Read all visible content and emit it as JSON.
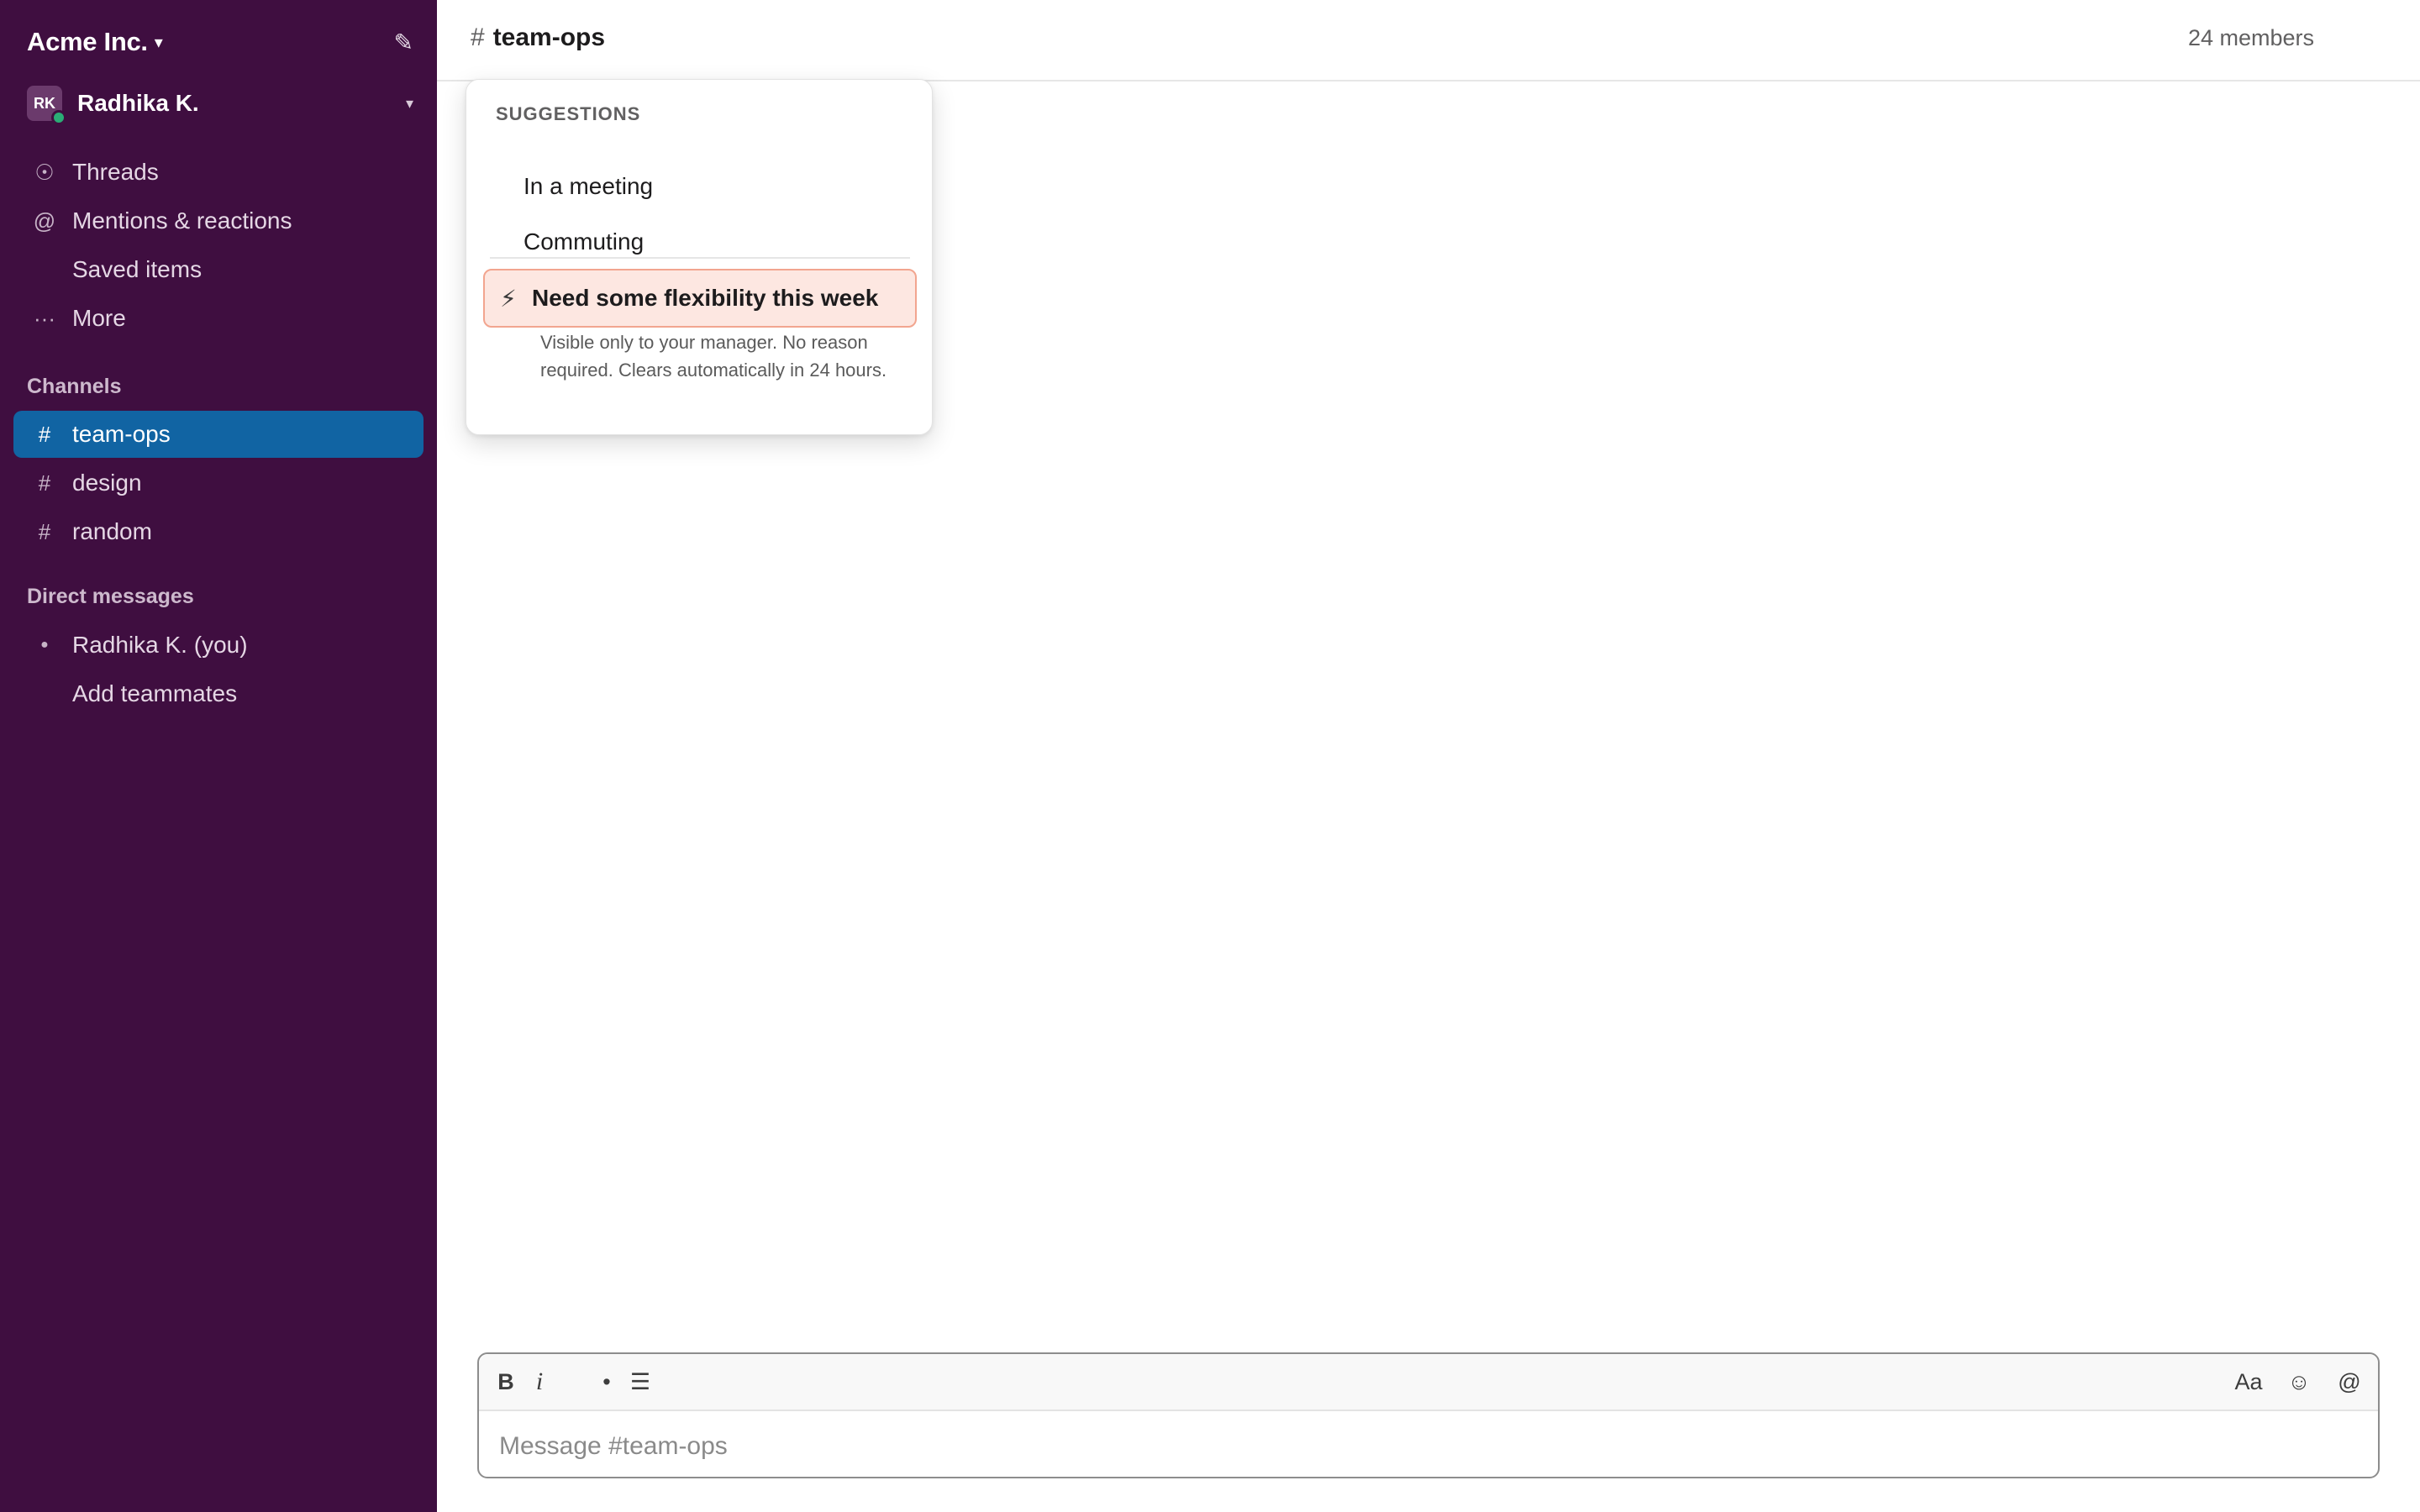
{
  "workspace": {
    "name": "Acme Inc.",
    "caret": "▾",
    "compose_icon": "✎"
  },
  "user": {
    "initials": "RK",
    "name": "Radhika K.",
    "caret": "▾",
    "status_color": "#2bac76"
  },
  "nav": [
    {
      "icon": "☉",
      "label": "Threads"
    },
    {
      "icon": "@",
      "label": "Mentions & reactions"
    },
    {
      "icon": "",
      "label": "Saved items"
    },
    {
      "icon": "···",
      "label": "More"
    }
  ],
  "channels": {
    "title": "Channels",
    "items": [
      {
        "icon": "#",
        "label": "team-ops"
      },
      {
        "icon": "#",
        "label": "design"
      },
      {
        "icon": "#",
        "label": "random"
      }
    ]
  },
  "dms": {
    "title": "Direct messages",
    "items": [
      {
        "icon": "●",
        "label": "Radhika K. (you)"
      },
      {
        "icon": "",
        "label": "Add teammates"
      }
    ]
  },
  "header": {
    "hash": "#",
    "channel": "team-ops",
    "members": "24 members",
    "icon1": "",
    "icon2": ""
  },
  "popover": {
    "label": "SUGGESTIONS",
    "suggestions": [
      {
        "icon": "",
        "label": "In a meeting"
      },
      {
        "icon": "",
        "label": "Commuting"
      }
    ],
    "flex": {
      "icon": "⚡",
      "label": "Need some flexibility this week",
      "desc": "Visible only to your manager. No reason required. Clears automatically in 24 hours."
    }
  },
  "composer": {
    "bold": "B",
    "italic": "i",
    "link": "",
    "bullet": "•",
    "list": "☰",
    "format": "Aa",
    "emoji": "☺",
    "mention": "@",
    "placeholder": "Message #team-ops"
  },
  "colors": {
    "sidebar": "#3f0e40",
    "active": "#1164a3",
    "highlight_bg": "#fde7e1",
    "highlight_border": "#f2a58f"
  }
}
